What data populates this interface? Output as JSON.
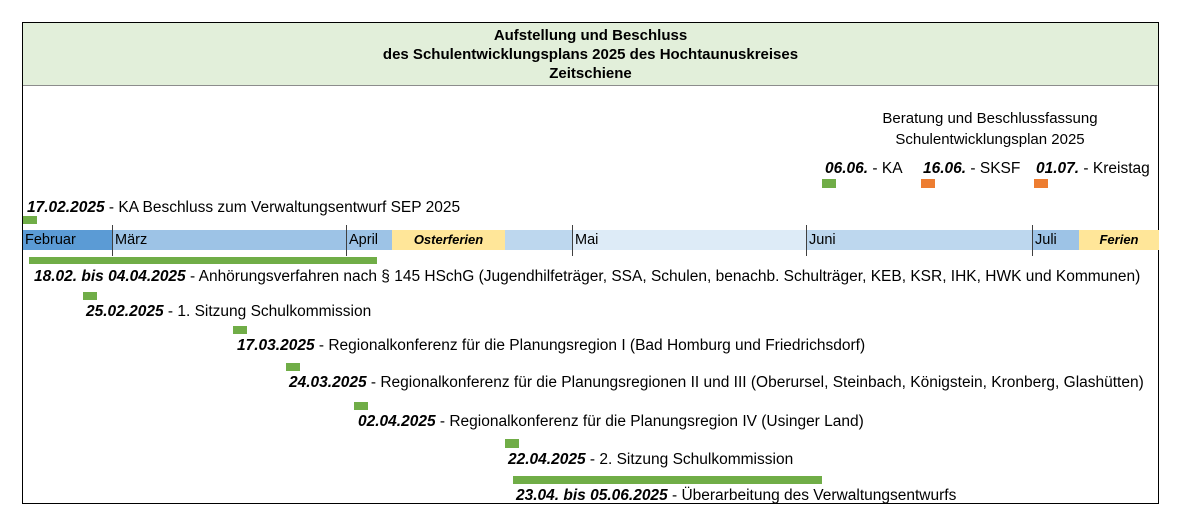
{
  "title": {
    "line1": "Aufstellung und Beschluss",
    "line2": "des Schulentwicklungsplans 2025 des Hochtaunuskreises",
    "line3": "Zeitschiene"
  },
  "beratung": {
    "caption_line1": "Beratung und Beschlussfassung",
    "caption_line2": "Schulentwicklungsplan 2025",
    "items": [
      {
        "date": "06.06.",
        "text": " - KA",
        "color": "#70ad47"
      },
      {
        "date": "16.06.",
        "text": " - SKSF",
        "color": "#ed7d31"
      },
      {
        "date": "01.07.",
        "text": " - Kreistag",
        "color": "#ed7d31"
      }
    ]
  },
  "timeline": {
    "months": [
      "Februar",
      "März",
      "April",
      "Mai",
      "Juni",
      "Juli"
    ],
    "holidays": [
      "Osterferien",
      "Ferien"
    ],
    "colors": {
      "februar": "#5b9bd5",
      "maerz": "#9dc3e6",
      "ferien": "#ffe699",
      "mai": "#bdd7ee",
      "juni": "#ddebf7"
    }
  },
  "events": [
    {
      "date": "17.02.2025",
      "text": " - KA Beschluss zum Verwaltungsentwurf SEP 2025"
    },
    {
      "date": "18.02. bis 04.04.2025",
      "text": " - Anhörungsverfahren nach § 145 HSchG (Jugendhilfeträger, SSA, Schulen, benachb. Schulträger, KEB, KSR, IHK, HWK und Kommunen)"
    },
    {
      "date": "25.02.2025",
      "text": " - 1. Sitzung Schulkommission"
    },
    {
      "date": "17.03.2025",
      "text": " - Regionalkonferenz für die Planungsregion I (Bad Homburg und Friedrichsdorf)"
    },
    {
      "date": "24.03.2025",
      "text": " - Regionalkonferenz für die Planungsregionen II und III (Oberursel, Steinbach, Königstein, Kronberg, Glashütten)"
    },
    {
      "date": "02.04.2025",
      "text": " - Regionalkonferenz für die Planungsregion IV (Usinger Land)"
    },
    {
      "date": "22.04.2025",
      "text": " - 2. Sitzung Schulkommission"
    },
    {
      "date": "23.04. bis 05.06.2025",
      "text": " - Überarbeitung des Verwaltungsentwurfs"
    }
  ]
}
